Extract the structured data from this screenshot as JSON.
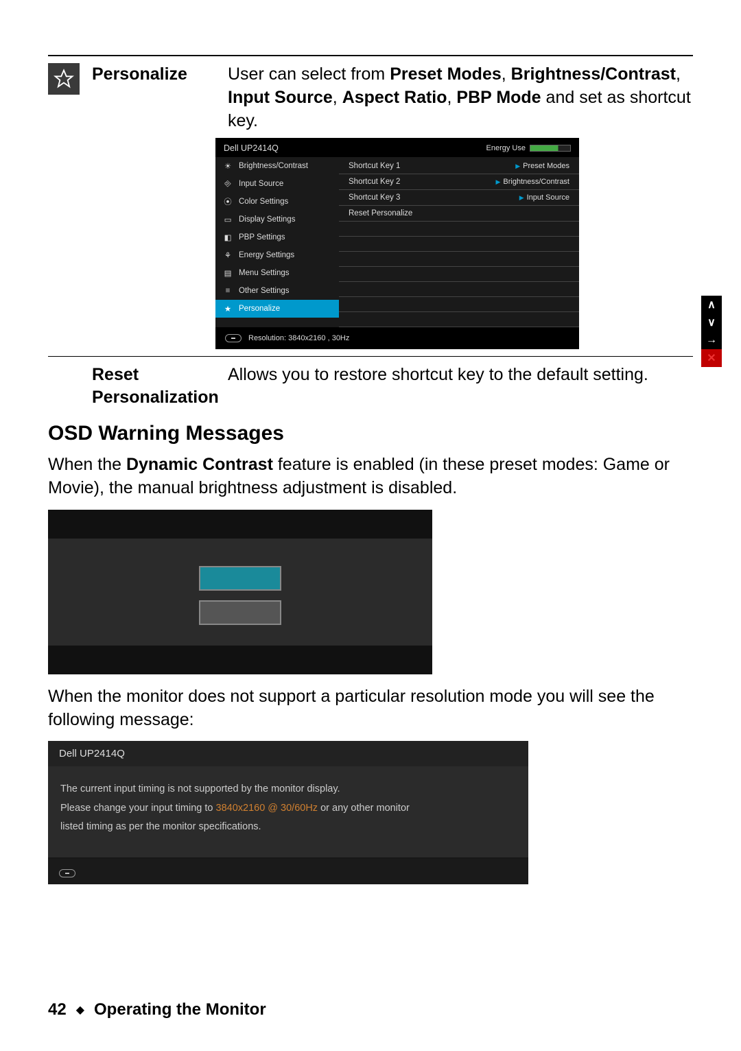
{
  "section1": {
    "title": "Personalize",
    "desc_pre": "User can select from ",
    "b1": "Preset Modes",
    "sep1": ", ",
    "b2": "Brightness/Contrast",
    "sep2": ", ",
    "b3": "Input Source",
    "sep3": ", ",
    "b4": "Aspect Ratio",
    "sep4": ", ",
    "b5": "PBP Mode",
    "desc_post": " and set as shortcut key."
  },
  "osd": {
    "model": "Dell UP2414Q",
    "energy_label": "Energy Use",
    "menu": {
      "i0": "Brightness/Contrast",
      "i1": "Input Source",
      "i2": "Color Settings",
      "i3": "Display Settings",
      "i4": "PBP Settings",
      "i5": "Energy Settings",
      "i6": "Menu Settings",
      "i7": "Other Settings",
      "i8": "Personalize"
    },
    "right": {
      "r0k": "Shortcut Key 1",
      "r0v": "Preset Modes",
      "r1k": "Shortcut Key 2",
      "r1v": "Brightness/Contrast",
      "r2k": "Shortcut Key 3",
      "r2v": "Input Source",
      "r3k": "Reset Personalize"
    },
    "footer": "Resolution: 3840x2160 , 30Hz"
  },
  "section2": {
    "title": "Reset Personalization",
    "desc": "Allows you to restore shortcut key to the default setting."
  },
  "heading": "OSD Warning Messages",
  "para1_pre": "When the ",
  "para1_b": "Dynamic Contrast",
  "para1_post": " feature is enabled (in these preset modes: Game or Movie), the manual brightness adjustment is disabled.",
  "para2": "When the monitor does not support a particular resolution mode you will see the following message:",
  "msg": {
    "model": "Dell UP2414Q",
    "l1": "The current input timing is not supported by the monitor display.",
    "l2a": "Please change your input timing to ",
    "l2hl": "3840x2160 @ 30/60Hz",
    "l2b": " or any other monitor",
    "l3": "listed timing as per the monitor specifications."
  },
  "footer": {
    "page": "42",
    "title": "Operating the Monitor"
  }
}
